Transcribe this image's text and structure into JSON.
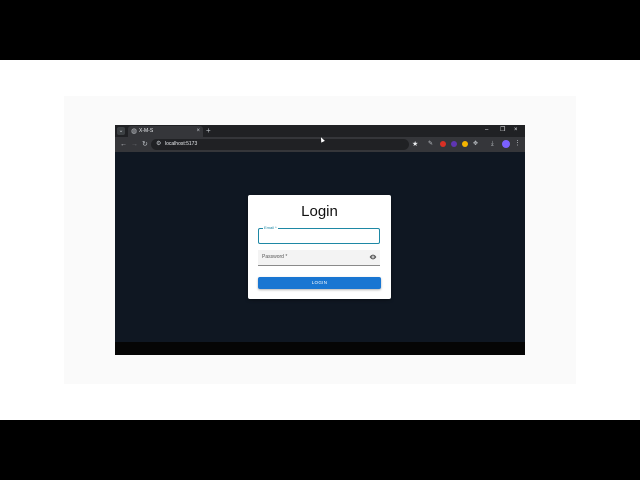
{
  "browser": {
    "tab_title": "X-M-S",
    "tab_close": "×",
    "new_tab": "+",
    "url": "localhost:5173",
    "window_controls": [
      "–",
      "❐",
      "×"
    ]
  },
  "login": {
    "title": "Login",
    "email_label": "Email *",
    "password_label": "Password *",
    "button_label": "LOGIN"
  },
  "colors": {
    "page_bg": "#0f1722",
    "accent": "#1976d2",
    "focus": "#1e88a5"
  },
  "icons": [
    "tab-search-icon",
    "globe-icon",
    "back-icon",
    "forward-icon",
    "reload-icon",
    "site-info-icon",
    "bookmark-star-icon",
    "edit-icon",
    "extension-icon",
    "download-icon",
    "profile-avatar",
    "more-menu-icon",
    "eye-icon"
  ]
}
